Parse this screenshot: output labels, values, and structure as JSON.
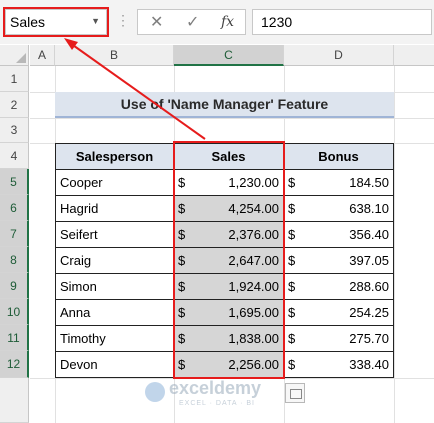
{
  "formula_bar": {
    "name_box": "Sales",
    "cancel_glyph": "✕",
    "enter_glyph": "✓",
    "fx_label": "fx",
    "value": "1230"
  },
  "columns": [
    "A",
    "B",
    "C",
    "D"
  ],
  "rows": [
    "1",
    "2",
    "3",
    "4",
    "5",
    "6",
    "7",
    "8",
    "9",
    "10",
    "11",
    "12"
  ],
  "title": "Use of 'Name Manager' Feature",
  "table": {
    "headers": [
      "Salesperson",
      "Sales",
      "Bonus"
    ],
    "currency": "$",
    "rows": [
      {
        "name": "Cooper",
        "sales": "1,230.00",
        "bonus": "184.50"
      },
      {
        "name": "Hagrid",
        "sales": "4,254.00",
        "bonus": "638.10"
      },
      {
        "name": "Seifert",
        "sales": "2,376.00",
        "bonus": "356.40"
      },
      {
        "name": "Craig",
        "sales": "2,647.00",
        "bonus": "397.05"
      },
      {
        "name": "Simon",
        "sales": "1,924.00",
        "bonus": "288.60"
      },
      {
        "name": "Anna",
        "sales": "1,695.00",
        "bonus": "254.25"
      },
      {
        "name": "Timothy",
        "sales": "1,838.00",
        "bonus": "275.70"
      },
      {
        "name": "Devon",
        "sales": "2,256.00",
        "bonus": "338.40"
      }
    ]
  },
  "watermark": {
    "brand": "exceldemy",
    "tagline": "EXCEL · DATA · BI"
  },
  "colors": {
    "highlight": "#e61c1c",
    "header_fill": "#dde4ee",
    "selection": "#217346"
  }
}
